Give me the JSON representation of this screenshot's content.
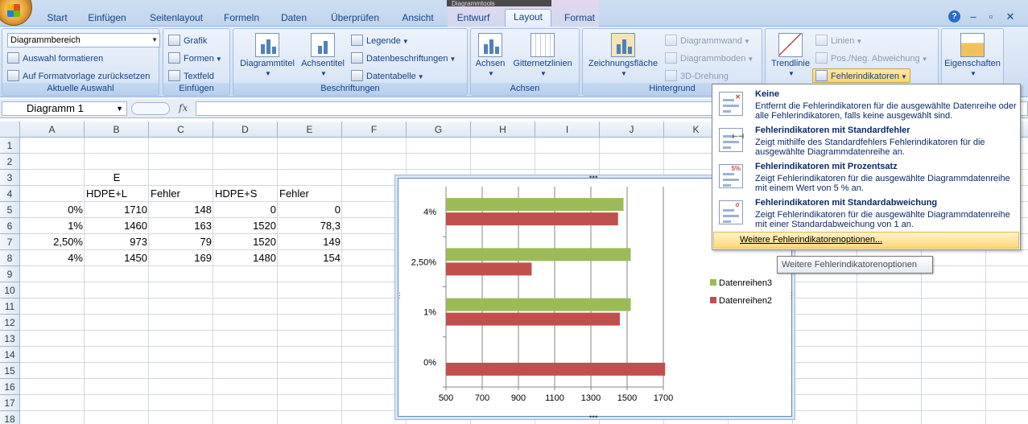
{
  "tabs": [
    "Start",
    "Einfügen",
    "Seitenlayout",
    "Formeln",
    "Daten",
    "Überprüfen",
    "Ansicht",
    "Entwurf",
    "Layout",
    "Format"
  ],
  "active_tab": "Layout",
  "context_title": "Diagrammtools",
  "ribbon": {
    "current_selection": {
      "selector_value": "Diagrammbereich",
      "format_selection": "Auswahl formatieren",
      "reset_style": "Auf Formatvorlage zurücksetzen",
      "label": "Aktuelle Auswahl"
    },
    "insert": {
      "picture": "Grafik",
      "shapes": "Formen",
      "textbox": "Textfeld",
      "label": "Einfügen"
    },
    "labels": {
      "chart_title": "Diagrammtitel",
      "axis_titles": "Achsentitel",
      "legend": "Legende",
      "data_labels": "Datenbeschriftungen",
      "data_table": "Datentabelle",
      "label": "Beschriftungen"
    },
    "axes": {
      "axes": "Achsen",
      "gridlines": "Gitternetzlinien",
      "label": "Achsen"
    },
    "background": {
      "plot_area": "Zeichnungsfläche",
      "chart_wall": "Diagrammwand",
      "chart_floor": "Diagrammboden",
      "rotation_3d": "3D-Drehung",
      "label": "Hintergrund"
    },
    "analysis": {
      "trendline": "Trendlinie",
      "lines": "Linien",
      "updown_bars": "Pos./Neg. Abweichung",
      "error_bars": "Fehlerindikatoren"
    },
    "properties": {
      "properties": "Eigenschaften"
    }
  },
  "formula_bar": {
    "name_box": "Diagramm 1",
    "fx": "fx",
    "value": ""
  },
  "sheet": {
    "columns": [
      "A",
      "B",
      "C",
      "D",
      "E",
      "F",
      "G",
      "H",
      "I",
      "J",
      "K"
    ],
    "rows": [
      "1",
      "2",
      "3",
      "4",
      "5",
      "6",
      "7",
      "8",
      "9",
      "10",
      "11",
      "12",
      "13",
      "14",
      "15",
      "16",
      "17",
      "18"
    ],
    "cells": {
      "B3": "E",
      "B4": "HDPE+L",
      "C4": "Fehler",
      "D4": "HDPE+S",
      "E4": "Fehler",
      "A5": "0%",
      "B5": "1710",
      "C5": "148",
      "D5": "0",
      "E5": "0",
      "A6": "1%",
      "B6": "1460",
      "C6": "163",
      "D6": "1520",
      "E6": "78,3",
      "A7": "2,50%",
      "B7": "973",
      "C7": "79",
      "D7": "1520",
      "E7": "149",
      "A8": "4%",
      "B8": "1450",
      "C8": "169",
      "D8": "1480",
      "E8": "154"
    }
  },
  "chart_data": {
    "type": "bar",
    "orientation": "horizontal",
    "categories": [
      "0%",
      "1%",
      "2,50%",
      "4%"
    ],
    "series": [
      {
        "name": "Datenreihen3",
        "values": [
          0,
          1520,
          1520,
          1480
        ],
        "color": "#9bbb59"
      },
      {
        "name": "Datenreihen2",
        "values": [
          1710,
          1460,
          973,
          1450
        ],
        "color": "#c0504d"
      }
    ],
    "x_ticks": [
      "500",
      "700",
      "900",
      "1100",
      "1300",
      "1500",
      "1700"
    ],
    "xlim": [
      500,
      1700
    ],
    "grid": "vertical major",
    "legend": "right"
  },
  "dropdown": {
    "items": [
      {
        "title": "Keine",
        "desc": "Entfernt die Fehlerindikatoren für die ausgewählte Datenreihe oder alle Fehlerindikatoren, falls keine ausgewählt sind."
      },
      {
        "title": "Fehlerindikatoren mit Standardfehler",
        "desc": "Zeigt mithilfe des Standardfehlers Fehlerindikatoren für die ausgewählte Diagrammdatenreihe an."
      },
      {
        "title": "Fehlerindikatoren mit Prozentsatz",
        "desc": "Zeigt Fehlerindikatoren für die ausgewählte Diagrammdatenreihe mit einem Wert von 5 % an."
      },
      {
        "title": "Fehlerindikatoren mit Standardabweichung",
        "desc": "Zeigt Fehlerindikatoren für die ausgewählte Diagrammdatenreihe mit einer Standardabweichung von 1 an."
      }
    ],
    "more": "Weitere Fehlerindikatorenoptionen...",
    "tooltip": "Weitere Fehlerindikatorenoptionen"
  },
  "colors": {
    "accent": "#15428b",
    "series_green": "#9bbb59",
    "series_red": "#c0504d",
    "highlight": "#ffd97a"
  },
  "icons": [
    "office-button-icon",
    "help-icon",
    "minimize-icon",
    "restore-icon",
    "close-icon",
    "fx-icon",
    "error-bars-icon"
  ]
}
